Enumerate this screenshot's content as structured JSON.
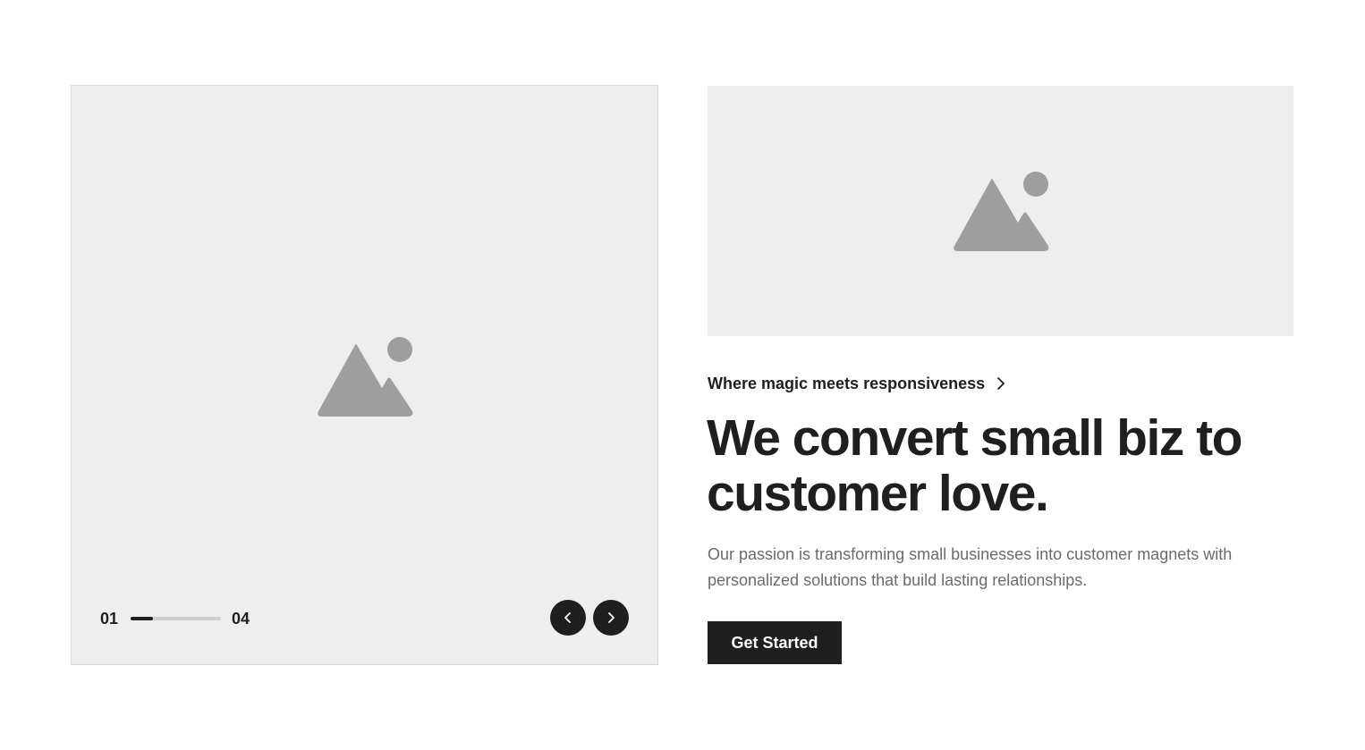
{
  "carousel": {
    "current": "01",
    "total": "04",
    "progress_fraction": 0.25,
    "prev_icon": "chevron-left-icon",
    "next_icon": "chevron-right-icon",
    "image_icon": "image-placeholder-icon"
  },
  "hero": {
    "image_icon": "image-placeholder-icon",
    "eyebrow": "Where magic meets responsiveness",
    "eyebrow_icon": "chevron-right-icon",
    "headline": "We convert small biz to customer love.",
    "description": "Our passion is transforming small businesses into customer magnets with personalized solutions that build lasting relationships.",
    "cta_label": "Get Started"
  },
  "colors": {
    "background": "#ffffff",
    "placeholder_bg": "#eeeeee",
    "placeholder_icon": "#9e9e9e",
    "text_primary": "#1f1f1f",
    "text_muted": "#6b6b6b",
    "accent": "#1f1f1f"
  }
}
